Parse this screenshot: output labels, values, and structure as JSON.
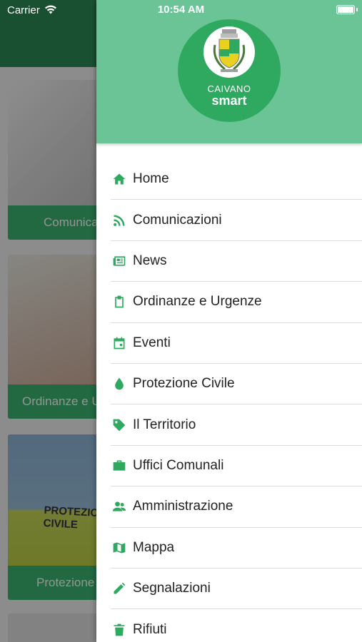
{
  "status_bar": {
    "carrier": "Carrier",
    "time": "10:54 AM"
  },
  "background": {
    "cards": [
      {
        "label": "Comunicazioni"
      },
      {
        "label": "Ordinanze e Urgenze"
      },
      {
        "label": "Protezione Civile"
      }
    ],
    "vest_text": "PROTEZIONE CIVILE"
  },
  "drawer": {
    "logo": {
      "city": "CAIVANO",
      "word": "smart"
    },
    "menu": [
      {
        "label": "Home",
        "icon": "home-icon"
      },
      {
        "label": "Comunicazioni",
        "icon": "rss-icon"
      },
      {
        "label": "News",
        "icon": "newspaper-icon"
      },
      {
        "label": "Ordinanze e Urgenze",
        "icon": "clipboard-icon"
      },
      {
        "label": "Eventi",
        "icon": "calendar-icon"
      },
      {
        "label": "Protezione Civile",
        "icon": "drop-icon"
      },
      {
        "label": "Il Territorio",
        "icon": "tag-icon"
      },
      {
        "label": "Uffici Comunali",
        "icon": "briefcase-icon"
      },
      {
        "label": "Amministrazione",
        "icon": "users-icon"
      },
      {
        "label": "Mappa",
        "icon": "map-icon"
      },
      {
        "label": "Segnalazioni",
        "icon": "pencil-icon"
      },
      {
        "label": "Rifiuti",
        "icon": "trash-icon"
      }
    ]
  },
  "colors": {
    "accent": "#2fa95f",
    "drawer_header": "#6ac496",
    "app_bar": "#2e8b57"
  }
}
